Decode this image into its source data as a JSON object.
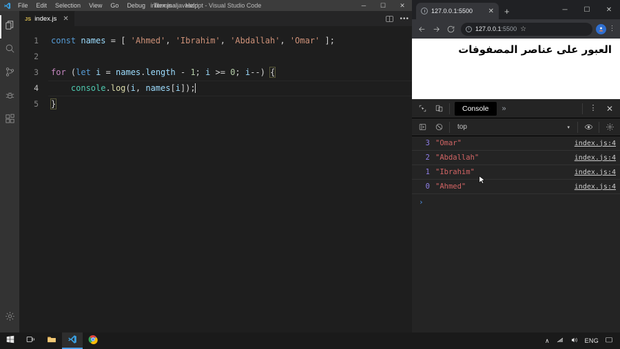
{
  "vscode": {
    "title": "index.js - javascript - Visual Studio Code",
    "menu": [
      "File",
      "Edit",
      "Selection",
      "View",
      "Go",
      "Debug",
      "Terminal",
      "Help"
    ],
    "window_controls": {
      "minimize": "─",
      "maximize": "☐",
      "close": "✕"
    },
    "activity_bar": [
      {
        "name": "explorer",
        "icon": "files-icon"
      },
      {
        "name": "search",
        "icon": "search-icon"
      },
      {
        "name": "source-control",
        "icon": "source-control-icon"
      },
      {
        "name": "run-debug",
        "icon": "debug-icon"
      },
      {
        "name": "extensions",
        "icon": "extensions-icon"
      },
      {
        "name": "manage",
        "icon": "gear-icon"
      }
    ],
    "tab": {
      "badge": "JS",
      "label": "index.js",
      "close": "✕"
    },
    "editor_actions": {
      "split": "split-editor-icon",
      "more": "•••"
    },
    "gutter": [
      "1",
      "2",
      "3",
      "4",
      "5"
    ],
    "code": {
      "line1": {
        "kw": "const",
        "var": "names",
        "eq": "=",
        "open": "[",
        "s1": "'Ahmed'",
        "c1": ",",
        "s2": "'Ibrahim'",
        "c2": ",",
        "s3": "'Abdallah'",
        "c3": ",",
        "s4": "'Omar'",
        "close": "]",
        "semi": ";"
      },
      "line3": {
        "kw": "for",
        "p1": "(",
        "let": "let",
        "i": "i",
        "eq": "=",
        "names": "names",
        "dot": ".",
        "length": "length",
        "minus": "-",
        "one": "1",
        "semi1": ";",
        "i2": "i",
        "gte": ">=",
        "zero": "0",
        "semi2": ";",
        "i3": "i",
        "dec": "--",
        "p2": ")",
        "brace": "{"
      },
      "line4": {
        "console": "console",
        "dot": ".",
        "log": "log",
        "p1": "(",
        "i": "i",
        "comma": ",",
        "names": "names",
        "b1": "[",
        "i2": "i",
        "b2": "]",
        "p2": ")",
        "semi": ";"
      },
      "line5": {
        "brace": "}"
      }
    }
  },
  "chrome": {
    "tab": {
      "title": "127.0.0.1:5500",
      "close": "✕"
    },
    "new_tab": "+",
    "window_controls": {
      "minimize": "─",
      "maximize": "☐",
      "close": "✕"
    },
    "nav": {
      "back": "back-arrow-icon",
      "forward": "forward-arrow-icon",
      "reload": "reload-icon"
    },
    "omnibox": {
      "info": "ⓘ",
      "url_host": "127.0.0.1",
      "url_port": ":5500",
      "star": "☆"
    },
    "kebab": "⋮",
    "page": {
      "heading": "العبور على عناصر المصفوفات"
    }
  },
  "devtools": {
    "toolbar": {
      "inspect": "inspect-element-icon",
      "device": "device-toolbar-icon",
      "active_tab": "Console",
      "overflow": "»",
      "kebab": "⋮",
      "close": "✕"
    },
    "filterbar": {
      "sidebar": "console-sidebar-icon",
      "clear": "clear-console-icon",
      "context": "top",
      "context_caret": "▾",
      "eye": "live-expression-icon",
      "settings": "settings-gear-icon"
    },
    "console_rows": [
      {
        "index": "3",
        "value": "\"Omar\"",
        "source": "index.js:4"
      },
      {
        "index": "2",
        "value": "\"Abdallah\"",
        "source": "index.js:4"
      },
      {
        "index": "1",
        "value": "\"Ibrahim\"",
        "source": "index.js:4"
      },
      {
        "index": "0",
        "value": "\"Ahmed\"",
        "source": "index.js:4"
      }
    ],
    "prompt": "›"
  },
  "taskbar": {
    "items": [
      {
        "name": "start-button",
        "icon": "windows-logo-icon"
      },
      {
        "name": "task-view-button",
        "icon": "task-view-icon"
      },
      {
        "name": "file-explorer-button",
        "icon": "folder-icon"
      },
      {
        "name": "vscode-button",
        "icon": "vscode-icon"
      },
      {
        "name": "chrome-button",
        "icon": "chrome-icon"
      }
    ],
    "tray": {
      "chevron": "∧",
      "network": "network-icon",
      "volume": "volume-icon",
      "language": "ENG",
      "notifications": "notification-icon"
    }
  },
  "colors": {
    "vscode_bg": "#1e1e1e",
    "vscode_chrome": "#3c3c3c",
    "devtools_bg": "#242424",
    "accent_blue": "#4a9eea",
    "console_index": "#8f7fe8",
    "console_string": "#d16464"
  }
}
